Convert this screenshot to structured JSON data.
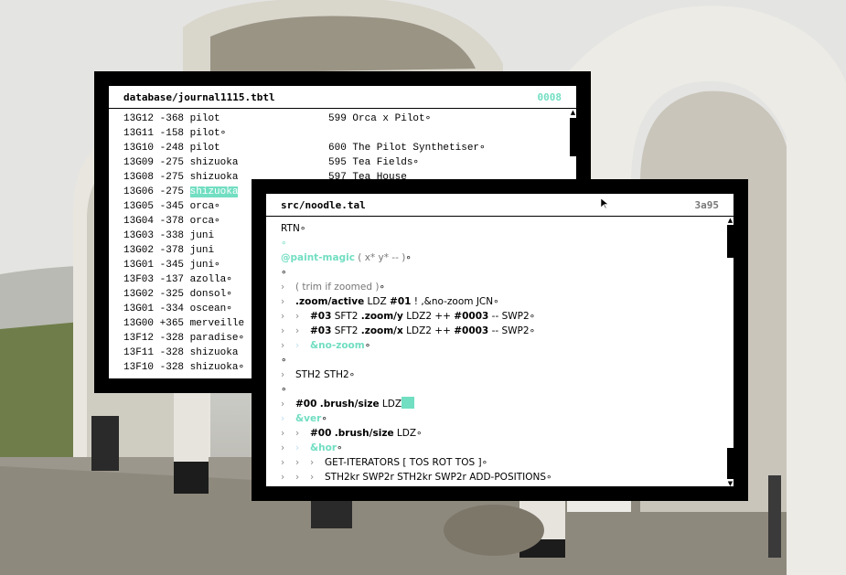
{
  "journal_window": {
    "title": "database/journal1115.tbtl",
    "address": "0008",
    "rows": [
      {
        "code": "13G12",
        "value": "-368",
        "name": "pilot",
        "dot": false,
        "entry": "599 Orca x Pilot",
        "entry_dot": true
      },
      {
        "code": "13G11",
        "value": "-158",
        "name": "pilot",
        "dot": true,
        "entry": "",
        "entry_dot": false
      },
      {
        "code": "13G10",
        "value": "-248",
        "name": "pilot",
        "dot": false,
        "entry": "600 The Pilot Synthetiser",
        "entry_dot": true
      },
      {
        "code": "13G09",
        "value": "-275",
        "name": "shizuoka",
        "dot": false,
        "entry": "595 Tea Fields",
        "entry_dot": true
      },
      {
        "code": "13G08",
        "value": "-275",
        "name": "shizuoka",
        "dot": false,
        "entry": "597 Tea House",
        "entry_dot": false
      },
      {
        "code": "13G06",
        "value": "-275",
        "name": "shizuoka",
        "dot": false,
        "entry": "",
        "entry_dot": false,
        "highlight": true
      },
      {
        "code": "13G05",
        "value": "-345",
        "name": "orca",
        "dot": true,
        "entry": "",
        "entry_dot": false
      },
      {
        "code": "13G04",
        "value": "-378",
        "name": "orca",
        "dot": true,
        "entry": "",
        "entry_dot": false
      },
      {
        "code": "13G03",
        "value": "-338",
        "name": "juni",
        "dot": false,
        "entry": "",
        "entry_dot": false
      },
      {
        "code": "13G02",
        "value": "-378",
        "name": "juni",
        "dot": false,
        "entry": "",
        "entry_dot": false
      },
      {
        "code": "13G01",
        "value": "-345",
        "name": "juni",
        "dot": true,
        "entry": "",
        "entry_dot": false
      },
      {
        "code": "13F03",
        "value": "-137",
        "name": "azolla",
        "dot": true,
        "entry": "",
        "entry_dot": false
      },
      {
        "code": "13G02",
        "value": "-325",
        "name": "donsol",
        "dot": true,
        "entry": "",
        "entry_dot": false
      },
      {
        "code": "13G01",
        "value": "-334",
        "name": "oscean",
        "dot": true,
        "entry": "",
        "entry_dot": false
      },
      {
        "code": "13G00",
        "value": "+365",
        "name": "merveille",
        "dot": false,
        "entry": "",
        "entry_dot": false
      },
      {
        "code": "13F12",
        "value": "-328",
        "name": "paradise",
        "dot": true,
        "entry": "",
        "entry_dot": false
      },
      {
        "code": "13F11",
        "value": "-328",
        "name": "shizuoka",
        "dot": false,
        "entry": "",
        "entry_dot": false
      },
      {
        "code": "13F10",
        "value": "-328",
        "name": "shizuoka",
        "dot": true,
        "entry": "",
        "entry_dot": false
      }
    ]
  },
  "code_window": {
    "title": "src/noodle.tal",
    "address": "3a95",
    "lines": [
      {
        "indent": 0,
        "parts": [
          {
            "t": "RTN",
            "s": ""
          },
          {
            "t": "∘",
            "s": "dot"
          }
        ]
      },
      {
        "indent": 0,
        "parts": [
          {
            "t": "∘",
            "s": "teal-dot"
          }
        ]
      },
      {
        "indent": 0,
        "parts": [
          {
            "t": "@paint-magic",
            "s": "teal"
          },
          {
            "t": " ( x* y* -- )",
            "s": "gray"
          },
          {
            "t": "∘",
            "s": "dot"
          }
        ]
      },
      {
        "indent": 0,
        "parts": [
          {
            "t": "∘",
            "s": "dot"
          }
        ]
      },
      {
        "indent": 1,
        "parts": [
          {
            "t": "( trim if zoomed )",
            "s": "gray"
          },
          {
            "t": "∘",
            "s": "dot"
          }
        ]
      },
      {
        "indent": 1,
        "parts": [
          {
            "t": ".zoom/active",
            "s": "bold"
          },
          {
            "t": " LDZ ",
            "s": ""
          },
          {
            "t": "#01",
            "s": "bold"
          },
          {
            "t": " ! ,&no-zoom JCN",
            "s": ""
          },
          {
            "t": "∘",
            "s": "dot"
          }
        ]
      },
      {
        "indent": 2,
        "parts": [
          {
            "t": "#03",
            "s": "bold"
          },
          {
            "t": " SFT2 ",
            "s": ""
          },
          {
            "t": ".zoom/y",
            "s": "bold"
          },
          {
            "t": " LDZ2 ++ ",
            "s": ""
          },
          {
            "t": "#0003",
            "s": "bold"
          },
          {
            "t": " -- SWP2",
            "s": ""
          },
          {
            "t": "∘",
            "s": "dot"
          }
        ]
      },
      {
        "indent": 2,
        "parts": [
          {
            "t": "#03",
            "s": "bold"
          },
          {
            "t": " SFT2 ",
            "s": ""
          },
          {
            "t": ".zoom/x",
            "s": "bold"
          },
          {
            "t": " LDZ2 ++ ",
            "s": ""
          },
          {
            "t": "#0003",
            "s": "bold"
          },
          {
            "t": " -- SWP2",
            "s": ""
          },
          {
            "t": "∘",
            "s": "dot"
          }
        ]
      },
      {
        "indent": 2,
        "light": true,
        "parts": [
          {
            "t": "&no-zoom",
            "s": "teal"
          },
          {
            "t": "∘",
            "s": "dot"
          }
        ]
      },
      {
        "indent": 0,
        "parts": [
          {
            "t": "∘",
            "s": "dot"
          }
        ]
      },
      {
        "indent": 1,
        "parts": [
          {
            "t": "STH2 STH2",
            "s": ""
          },
          {
            "t": "∘",
            "s": "dot"
          }
        ]
      },
      {
        "indent": 0,
        "parts": [
          {
            "t": "∘",
            "s": "dot"
          }
        ]
      },
      {
        "indent": 1,
        "parts": [
          {
            "t": "#00",
            "s": "bold"
          },
          {
            "t": " ",
            "s": ""
          },
          {
            "t": ".brush/size",
            "s": "bold"
          },
          {
            "t": " LDZ",
            "s": ""
          },
          {
            "t": "",
            "s": "cursor"
          }
        ]
      },
      {
        "indent": 1,
        "light": true,
        "parts": [
          {
            "t": "&ver",
            "s": "teal"
          },
          {
            "t": "∘",
            "s": "dot"
          }
        ]
      },
      {
        "indent": 2,
        "parts": [
          {
            "t": "#00",
            "s": "bold"
          },
          {
            "t": " ",
            "s": ""
          },
          {
            "t": ".brush/size",
            "s": "bold"
          },
          {
            "t": " LDZ",
            "s": ""
          },
          {
            "t": "∘",
            "s": "dot"
          }
        ]
      },
      {
        "indent": 2,
        "light": true,
        "parts": [
          {
            "t": "&hor",
            "s": "teal"
          },
          {
            "t": "∘",
            "s": "dot"
          }
        ]
      },
      {
        "indent": 3,
        "parts": [
          {
            "t": "GET-ITERATORS [ TOS ROT TOS ]",
            "s": ""
          },
          {
            "t": "∘",
            "s": "dot"
          }
        ]
      },
      {
        "indent": 3,
        "parts": [
          {
            "t": "STH2kr SWP2r STH2kr SWP2r ADD-POSITIONS",
            "s": ""
          },
          {
            "t": "∘",
            "s": "dot"
          }
        ]
      }
    ]
  },
  "colors": {
    "accent": "#72dec2",
    "frame": "#000000",
    "panel": "#ffffff"
  },
  "cursor_icon": "mouse-pointer-icon"
}
